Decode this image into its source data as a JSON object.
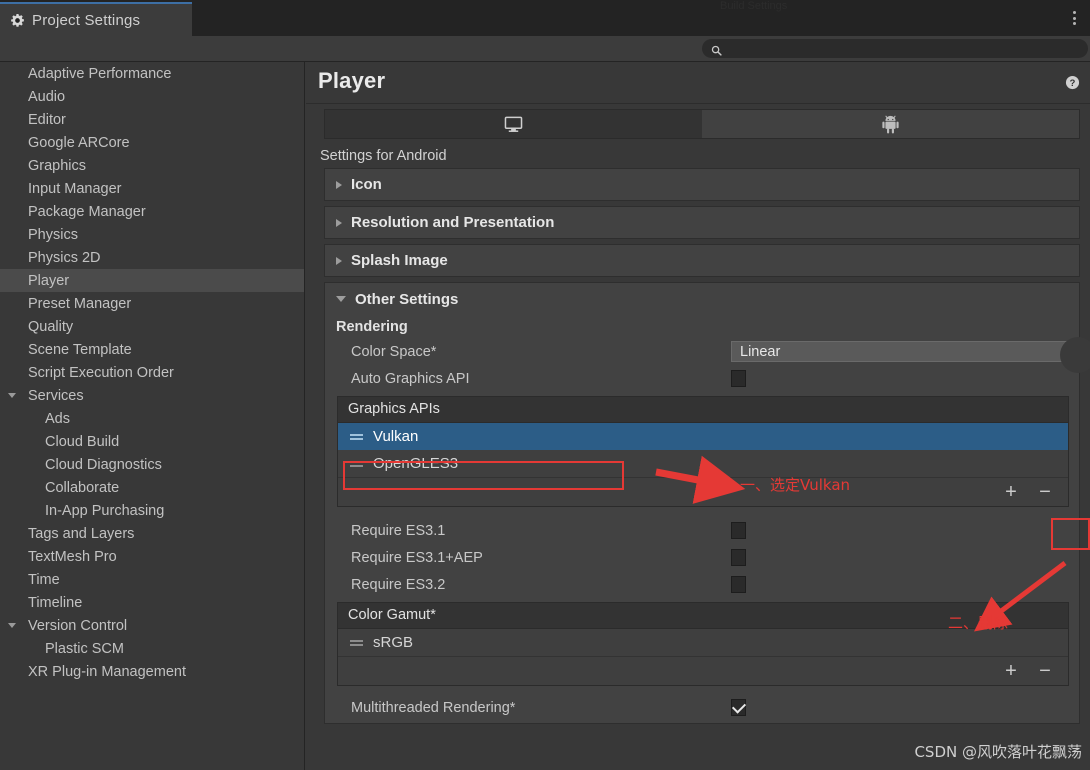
{
  "window": {
    "tab_title": "Project Settings",
    "tab_icon": "gear-icon",
    "ghost_tab_title": "Build Settings",
    "menu_icon": "kebab-menu-icon"
  },
  "search": {
    "placeholder": "",
    "value": "",
    "icon": "search-icon"
  },
  "sidebar": {
    "items": [
      {
        "label": "Adaptive Performance",
        "level": 0,
        "selected": false,
        "expander": "none"
      },
      {
        "label": "Audio",
        "level": 0,
        "selected": false,
        "expander": "none"
      },
      {
        "label": "Editor",
        "level": 0,
        "selected": false,
        "expander": "none"
      },
      {
        "label": "Google ARCore",
        "level": 0,
        "selected": false,
        "expander": "none"
      },
      {
        "label": "Graphics",
        "level": 0,
        "selected": false,
        "expander": "none"
      },
      {
        "label": "Input Manager",
        "level": 0,
        "selected": false,
        "expander": "none"
      },
      {
        "label": "Package Manager",
        "level": 0,
        "selected": false,
        "expander": "none"
      },
      {
        "label": "Physics",
        "level": 0,
        "selected": false,
        "expander": "none"
      },
      {
        "label": "Physics 2D",
        "level": 0,
        "selected": false,
        "expander": "none"
      },
      {
        "label": "Player",
        "level": 0,
        "selected": true,
        "expander": "none"
      },
      {
        "label": "Preset Manager",
        "level": 0,
        "selected": false,
        "expander": "none"
      },
      {
        "label": "Quality",
        "level": 0,
        "selected": false,
        "expander": "none"
      },
      {
        "label": "Scene Template",
        "level": 0,
        "selected": false,
        "expander": "none"
      },
      {
        "label": "Script Execution Order",
        "level": 0,
        "selected": false,
        "expander": "none"
      },
      {
        "label": "Services",
        "level": 0,
        "selected": false,
        "expander": "open"
      },
      {
        "label": "Ads",
        "level": 1,
        "selected": false,
        "expander": "none"
      },
      {
        "label": "Cloud Build",
        "level": 1,
        "selected": false,
        "expander": "none"
      },
      {
        "label": "Cloud Diagnostics",
        "level": 1,
        "selected": false,
        "expander": "none"
      },
      {
        "label": "Collaborate",
        "level": 1,
        "selected": false,
        "expander": "none"
      },
      {
        "label": "In-App Purchasing",
        "level": 1,
        "selected": false,
        "expander": "none"
      },
      {
        "label": "Tags and Layers",
        "level": 0,
        "selected": false,
        "expander": "none"
      },
      {
        "label": "TextMesh Pro",
        "level": 0,
        "selected": false,
        "expander": "none"
      },
      {
        "label": "Time",
        "level": 0,
        "selected": false,
        "expander": "none"
      },
      {
        "label": "Timeline",
        "level": 0,
        "selected": false,
        "expander": "none"
      },
      {
        "label": "Version Control",
        "level": 0,
        "selected": false,
        "expander": "open"
      },
      {
        "label": "Plastic SCM",
        "level": 1,
        "selected": false,
        "expander": "none"
      },
      {
        "label": "XR Plug-in Management",
        "level": 0,
        "selected": false,
        "expander": "none"
      }
    ]
  },
  "main": {
    "title": "Player",
    "help_icon": "help-icon",
    "platform_tabs": [
      {
        "icon": "standalone-monitor-icon",
        "active": true
      },
      {
        "icon": "android-robot-icon",
        "active": false
      }
    ],
    "settings_for": "Settings for Android",
    "foldouts": [
      {
        "label": "Icon",
        "open": false
      },
      {
        "label": "Resolution and Presentation",
        "open": false
      },
      {
        "label": "Splash Image",
        "open": false
      },
      {
        "label": "Other Settings",
        "open": true
      }
    ],
    "other_settings": {
      "rendering_heading": "Rendering",
      "color_space": {
        "label": "Color Space*",
        "value": "Linear"
      },
      "auto_graphics_api": {
        "label": "Auto Graphics API",
        "checked": false
      },
      "graphics_apis": {
        "header": "Graphics APIs",
        "rows": [
          {
            "label": "Vulkan",
            "selected": true
          },
          {
            "label": "OpenGLES3",
            "selected": false
          }
        ],
        "add_label": "+",
        "remove_label": "−"
      },
      "require_rows": [
        {
          "label": "Require ES3.1",
          "checked": false
        },
        {
          "label": "Require ES3.1+AEP",
          "checked": false
        },
        {
          "label": "Require ES3.2",
          "checked": false
        }
      ],
      "color_gamut": {
        "header": "Color Gamut*",
        "rows": [
          {
            "label": "sRGB",
            "selected": false
          }
        ],
        "add_label": "+",
        "remove_label": "−"
      },
      "multithreaded_rendering": {
        "label": "Multithreaded Rendering*",
        "checked": true
      }
    }
  },
  "annotations": [
    {
      "id": "step-1",
      "text": "一、选定Vulkan",
      "color": "#e53935"
    },
    {
      "id": "step-2",
      "text": "二、删除",
      "color": "#e53935"
    }
  ],
  "watermark": {
    "text": "CSDN @风吹落叶花飘荡"
  },
  "colors": {
    "window_bg": "#383838",
    "titlebar_bg": "#232323",
    "tab_accent": "#3d6fa5",
    "selection_blue": "#2c5d87",
    "annotation_red": "#e53935",
    "panel_bg": "#424242"
  }
}
